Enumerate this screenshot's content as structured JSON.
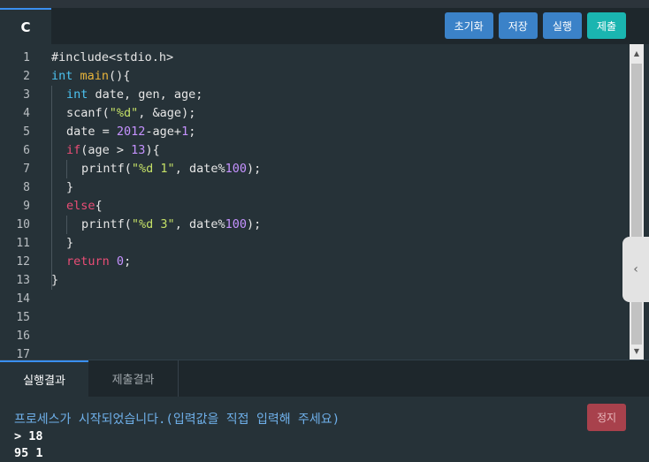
{
  "editor_tab": {
    "language": "C"
  },
  "toolbar": {
    "reset_label": "초기화",
    "save_label": "저장",
    "run_label": "실행",
    "submit_label": "제출"
  },
  "editor": {
    "line_numbers": [
      "1",
      "2",
      "3",
      "4",
      "5",
      "6",
      "7",
      "8",
      "9",
      "10",
      "11",
      "12",
      "13",
      "14",
      "15",
      "16",
      "17"
    ],
    "code": {
      "l1": "#include<stdio.h>",
      "l2_kw": "int",
      "l2_fn": "main",
      "l2_rest": "(){",
      "l3_kw": "int",
      "l3_rest": " date, gen, age;",
      "l4_a": "scanf(",
      "l4_str": "\"%d\"",
      "l4_b": ", &age);",
      "l5_a": "date = ",
      "l5_num1": "2012",
      "l5_b": "-age+",
      "l5_num2": "1",
      "l5_c": ";",
      "l6_kw": "if",
      "l6_a": "(age > ",
      "l6_num": "13",
      "l6_b": "){",
      "l7_a": "printf(",
      "l7_str": "\"%d 1\"",
      "l7_b": ", date%",
      "l7_num": "100",
      "l7_c": ");",
      "l8": "}",
      "l9_kw": "else",
      "l9_b": "{",
      "l10_a": "printf(",
      "l10_str": "\"%d 3\"",
      "l10_b": ", date%",
      "l10_num": "100",
      "l10_c": ");",
      "l11": "}",
      "l12_kw": "return",
      "l12_sp": " ",
      "l12_num": "0",
      "l12_c": ";",
      "l13": "}"
    }
  },
  "scrollbar": {
    "up_icon": "▲",
    "down_icon": "▼"
  },
  "side_handle": {
    "icon": "‹"
  },
  "result_tabs": {
    "run_result": "실행결과",
    "submit_result": "제출결과"
  },
  "console": {
    "message": "프로세스가 시작되었습니다.(입력값을 직접 입력해 주세요)",
    "input_line": "> 18",
    "output_line": "95 1",
    "stop_label": "정지"
  },
  "colors": {
    "accent_blue": "#3b82c8",
    "accent_teal": "#1ab5b0",
    "stop_red": "#a8414c",
    "editor_bg": "#263238"
  }
}
